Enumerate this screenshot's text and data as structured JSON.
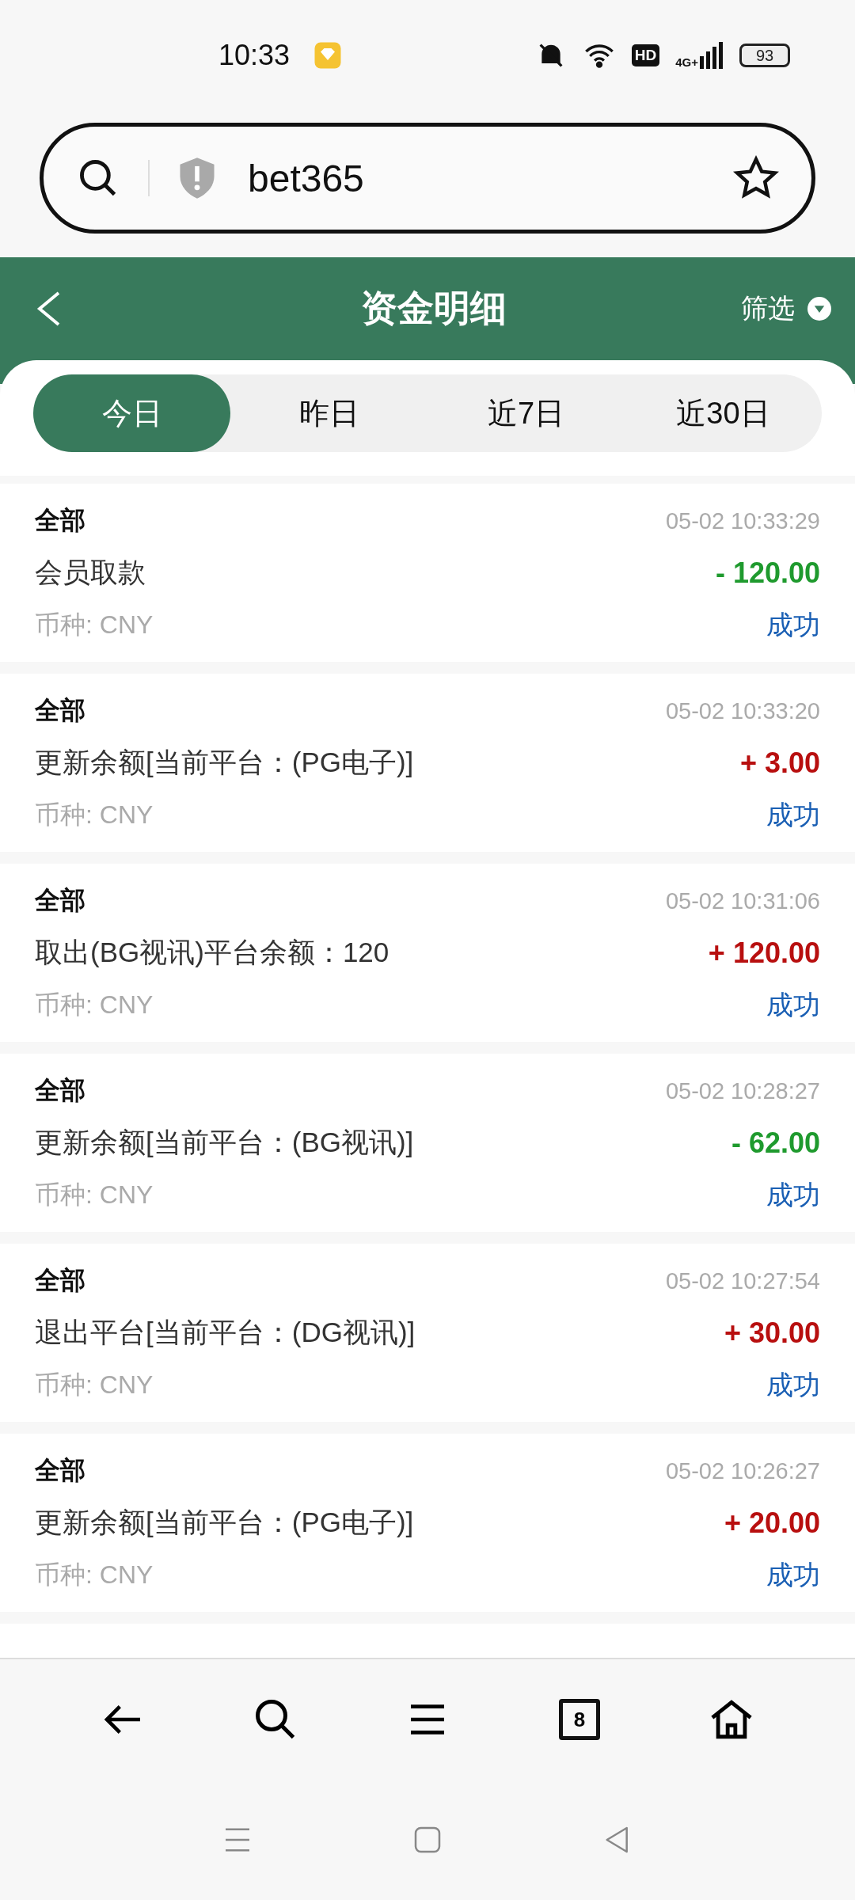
{
  "status_bar": {
    "time": "10:33",
    "network": "4G+",
    "hd": "HD",
    "battery": "93"
  },
  "address_bar": {
    "url": "bet365"
  },
  "header": {
    "title": "资金明细",
    "filter": "筛选"
  },
  "tabs": [
    {
      "label": "今日",
      "selected": true
    },
    {
      "label": "昨日",
      "selected": false
    },
    {
      "label": "近7日",
      "selected": false
    },
    {
      "label": "近30日",
      "selected": false
    }
  ],
  "records": [
    {
      "category": "全部",
      "time": "05-02 10:33:29",
      "description": "会员取款",
      "amount": "- 120.00",
      "color": "#1f9a2e",
      "currency": "币种: CNY",
      "status": "成功"
    },
    {
      "category": "全部",
      "time": "05-02 10:33:20",
      "description": "更新余额[当前平台：(PG电子)]",
      "amount": "+ 3.00",
      "color": "#b80f0f",
      "currency": "币种: CNY",
      "status": "成功"
    },
    {
      "category": "全部",
      "time": "05-02 10:31:06",
      "description": "取出(BG视讯)平台余额：120",
      "amount": "+ 120.00",
      "color": "#b80f0f",
      "currency": "币种: CNY",
      "status": "成功"
    },
    {
      "category": "全部",
      "time": "05-02 10:28:27",
      "description": "更新余额[当前平台：(BG视讯)]",
      "amount": "- 62.00",
      "color": "#1f9a2e",
      "currency": "币种: CNY",
      "status": "成功"
    },
    {
      "category": "全部",
      "time": "05-02 10:27:54",
      "description": "退出平台[当前平台：(DG视讯)]",
      "amount": "+ 30.00",
      "color": "#b80f0f",
      "currency": "币种: CNY",
      "status": "成功"
    },
    {
      "category": "全部",
      "time": "05-02 10:26:27",
      "description": "更新余额[当前平台：(PG电子)]",
      "amount": "+ 20.00",
      "color": "#b80f0f",
      "currency": "币种: CNY",
      "status": "成功"
    }
  ],
  "browser_toolbar": {
    "tab_count": "8"
  }
}
